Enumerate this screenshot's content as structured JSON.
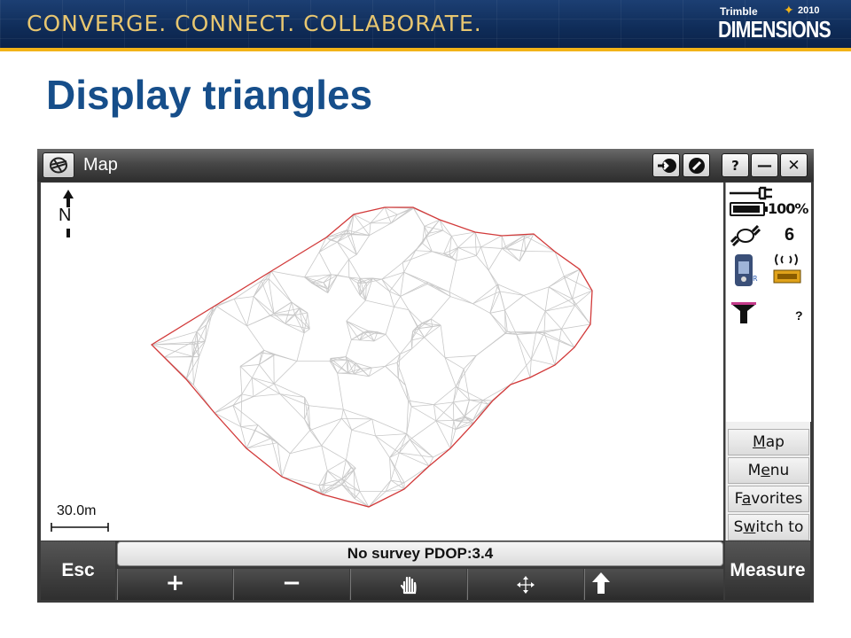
{
  "banner": {
    "tagline": "CONVERGE. CONNECT. COLLABORATE.",
    "logo_top": "Trimble",
    "logo_year": "2010",
    "logo_main": "DIMENSIONS"
  },
  "slide": {
    "title": "Display triangles"
  },
  "window": {
    "title": "Map",
    "buttons": {
      "help": "?",
      "minimize": "—",
      "close": "✕"
    }
  },
  "map": {
    "north_label": "N",
    "scale_label": "30.0m"
  },
  "status_panel": {
    "battery": "100%",
    "satellites": "6",
    "unknown": "?"
  },
  "side_menu": [
    {
      "label": "Map",
      "mnemonic_index": 0
    },
    {
      "label": "Menu",
      "mnemonic_index": 1
    },
    {
      "label": "Favorites",
      "mnemonic_index": 1
    },
    {
      "label": "Switch to",
      "mnemonic_index": 1
    }
  ],
  "status_bar": {
    "text": "No survey  PDOP:3.4"
  },
  "bottom": {
    "esc": "Esc",
    "measure": "Measure",
    "zoom_in": "+",
    "zoom_out": "−"
  },
  "colors": {
    "banner": "#0f2c58",
    "title": "#164e8a",
    "boundary": "#d23a3a",
    "mesh": "#c8c8c8"
  }
}
